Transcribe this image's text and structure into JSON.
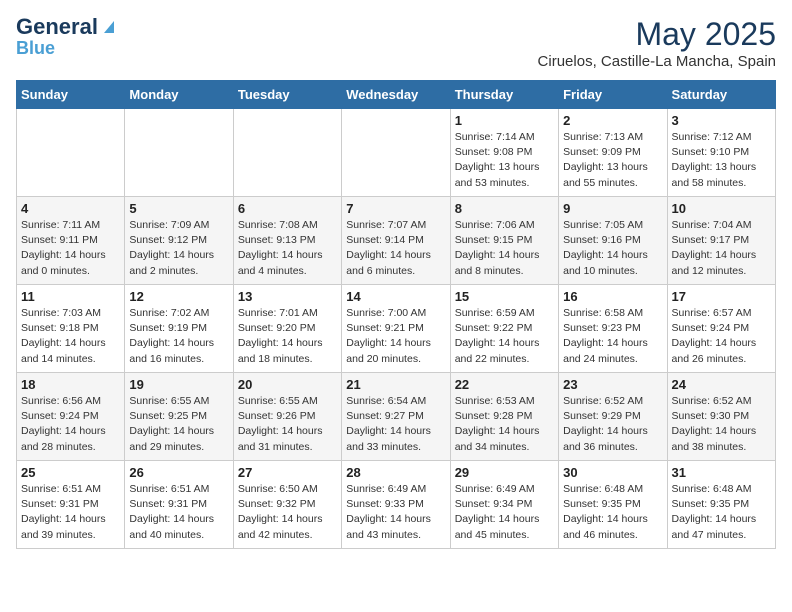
{
  "logo": {
    "general": "General",
    "blue": "Blue"
  },
  "header": {
    "month": "May 2025",
    "location": "Ciruelos, Castille-La Mancha, Spain"
  },
  "columns": [
    "Sunday",
    "Monday",
    "Tuesday",
    "Wednesday",
    "Thursday",
    "Friday",
    "Saturday"
  ],
  "weeks": [
    [
      {
        "day": "",
        "info": ""
      },
      {
        "day": "",
        "info": ""
      },
      {
        "day": "",
        "info": ""
      },
      {
        "day": "",
        "info": ""
      },
      {
        "day": "1",
        "info": "Sunrise: 7:14 AM\nSunset: 9:08 PM\nDaylight: 13 hours\nand 53 minutes."
      },
      {
        "day": "2",
        "info": "Sunrise: 7:13 AM\nSunset: 9:09 PM\nDaylight: 13 hours\nand 55 minutes."
      },
      {
        "day": "3",
        "info": "Sunrise: 7:12 AM\nSunset: 9:10 PM\nDaylight: 13 hours\nand 58 minutes."
      }
    ],
    [
      {
        "day": "4",
        "info": "Sunrise: 7:11 AM\nSunset: 9:11 PM\nDaylight: 14 hours\nand 0 minutes."
      },
      {
        "day": "5",
        "info": "Sunrise: 7:09 AM\nSunset: 9:12 PM\nDaylight: 14 hours\nand 2 minutes."
      },
      {
        "day": "6",
        "info": "Sunrise: 7:08 AM\nSunset: 9:13 PM\nDaylight: 14 hours\nand 4 minutes."
      },
      {
        "day": "7",
        "info": "Sunrise: 7:07 AM\nSunset: 9:14 PM\nDaylight: 14 hours\nand 6 minutes."
      },
      {
        "day": "8",
        "info": "Sunrise: 7:06 AM\nSunset: 9:15 PM\nDaylight: 14 hours\nand 8 minutes."
      },
      {
        "day": "9",
        "info": "Sunrise: 7:05 AM\nSunset: 9:16 PM\nDaylight: 14 hours\nand 10 minutes."
      },
      {
        "day": "10",
        "info": "Sunrise: 7:04 AM\nSunset: 9:17 PM\nDaylight: 14 hours\nand 12 minutes."
      }
    ],
    [
      {
        "day": "11",
        "info": "Sunrise: 7:03 AM\nSunset: 9:18 PM\nDaylight: 14 hours\nand 14 minutes."
      },
      {
        "day": "12",
        "info": "Sunrise: 7:02 AM\nSunset: 9:19 PM\nDaylight: 14 hours\nand 16 minutes."
      },
      {
        "day": "13",
        "info": "Sunrise: 7:01 AM\nSunset: 9:20 PM\nDaylight: 14 hours\nand 18 minutes."
      },
      {
        "day": "14",
        "info": "Sunrise: 7:00 AM\nSunset: 9:21 PM\nDaylight: 14 hours\nand 20 minutes."
      },
      {
        "day": "15",
        "info": "Sunrise: 6:59 AM\nSunset: 9:22 PM\nDaylight: 14 hours\nand 22 minutes."
      },
      {
        "day": "16",
        "info": "Sunrise: 6:58 AM\nSunset: 9:23 PM\nDaylight: 14 hours\nand 24 minutes."
      },
      {
        "day": "17",
        "info": "Sunrise: 6:57 AM\nSunset: 9:24 PM\nDaylight: 14 hours\nand 26 minutes."
      }
    ],
    [
      {
        "day": "18",
        "info": "Sunrise: 6:56 AM\nSunset: 9:24 PM\nDaylight: 14 hours\nand 28 minutes."
      },
      {
        "day": "19",
        "info": "Sunrise: 6:55 AM\nSunset: 9:25 PM\nDaylight: 14 hours\nand 29 minutes."
      },
      {
        "day": "20",
        "info": "Sunrise: 6:55 AM\nSunset: 9:26 PM\nDaylight: 14 hours\nand 31 minutes."
      },
      {
        "day": "21",
        "info": "Sunrise: 6:54 AM\nSunset: 9:27 PM\nDaylight: 14 hours\nand 33 minutes."
      },
      {
        "day": "22",
        "info": "Sunrise: 6:53 AM\nSunset: 9:28 PM\nDaylight: 14 hours\nand 34 minutes."
      },
      {
        "day": "23",
        "info": "Sunrise: 6:52 AM\nSunset: 9:29 PM\nDaylight: 14 hours\nand 36 minutes."
      },
      {
        "day": "24",
        "info": "Sunrise: 6:52 AM\nSunset: 9:30 PM\nDaylight: 14 hours\nand 38 minutes."
      }
    ],
    [
      {
        "day": "25",
        "info": "Sunrise: 6:51 AM\nSunset: 9:31 PM\nDaylight: 14 hours\nand 39 minutes."
      },
      {
        "day": "26",
        "info": "Sunrise: 6:51 AM\nSunset: 9:31 PM\nDaylight: 14 hours\nand 40 minutes."
      },
      {
        "day": "27",
        "info": "Sunrise: 6:50 AM\nSunset: 9:32 PM\nDaylight: 14 hours\nand 42 minutes."
      },
      {
        "day": "28",
        "info": "Sunrise: 6:49 AM\nSunset: 9:33 PM\nDaylight: 14 hours\nand 43 minutes."
      },
      {
        "day": "29",
        "info": "Sunrise: 6:49 AM\nSunset: 9:34 PM\nDaylight: 14 hours\nand 45 minutes."
      },
      {
        "day": "30",
        "info": "Sunrise: 6:48 AM\nSunset: 9:35 PM\nDaylight: 14 hours\nand 46 minutes."
      },
      {
        "day": "31",
        "info": "Sunrise: 6:48 AM\nSunset: 9:35 PM\nDaylight: 14 hours\nand 47 minutes."
      }
    ]
  ]
}
